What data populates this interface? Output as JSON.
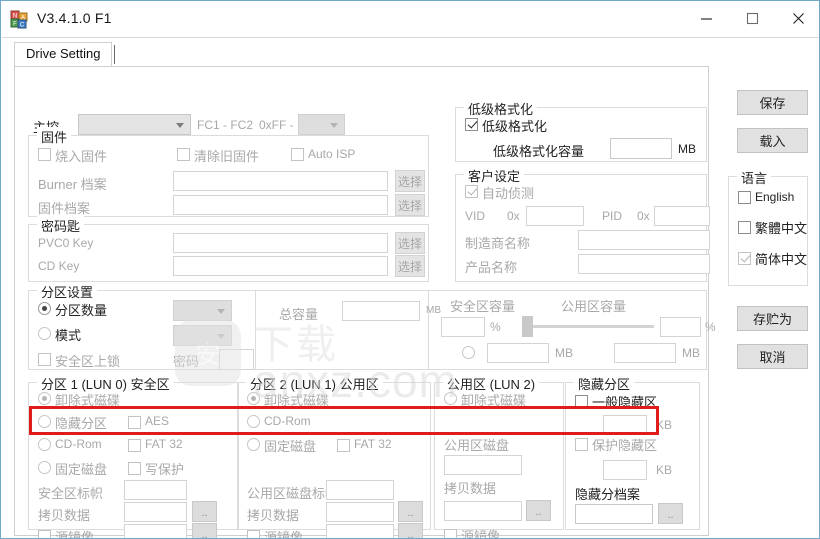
{
  "window": {
    "title": "V3.4.1.0 F1",
    "app_icon": "blocks-icon",
    "minimize": "−",
    "maximize": "□",
    "close": "✕"
  },
  "tabs": [
    {
      "label": "Drive Setting",
      "active": true
    }
  ],
  "controller": {
    "label": "主控",
    "combo_value": "",
    "range_text": "FC1 - FC2",
    "hex_text": "0xFF -",
    "combo2_value": ""
  },
  "firmware": {
    "title": "固件",
    "burn_firmware": "烧入固件",
    "clear_old_firmware": "清除旧固件",
    "auto_isp": "Auto ISP",
    "burner_file_label": "Burner 档案",
    "burner_file_value": "",
    "firmware_file_label": "固件档案",
    "firmware_file_value": "",
    "browse_label": "选择"
  },
  "keys": {
    "title": "密码匙",
    "pvc0_label": "PVC0 Key",
    "pvc0_value": "",
    "cd_label": "CD Key",
    "cd_value": "",
    "browse_label": "选择"
  },
  "partition_settings": {
    "title": "分区设置",
    "count_label": "分区数量",
    "count_value": "",
    "mode_label": "模式",
    "mode_value": "",
    "secure_lock_label": "安全区上锁",
    "password_label": "密码",
    "password_value": ""
  },
  "capacity": {
    "total_label": "总容量",
    "total_value": "",
    "total_unit": "MB",
    "secure_label": "安全区容量",
    "secure_percent": "",
    "secure_percent_unit": "%",
    "secure_mb": "",
    "secure_mb_unit": "MB",
    "public_label": "公用区容量",
    "public_percent": "",
    "public_percent_unit": "%",
    "public_mb": "",
    "public_mb_unit": "MB",
    "slider_position_percent": 4
  },
  "low_level_format": {
    "title": "低级格式化",
    "checkbox_label": "低级格式化",
    "checked": true,
    "capacity_label": "低级格式化容量",
    "capacity_value": "",
    "capacity_unit": "MB"
  },
  "customer_settings": {
    "title": "客户设定",
    "auto_detect": "自动侦测",
    "auto_detect_checked": true,
    "vid_label": "VID",
    "vid_prefix": "0x",
    "vid_value": "",
    "pid_label": "PID",
    "pid_prefix": "0x",
    "pid_value": "",
    "manufacturer_label": "制造商名称",
    "manufacturer_value": "",
    "product_label": "产品名称",
    "product_value": ""
  },
  "partition1": {
    "title": "分区 1 (LUN 0) 安全区",
    "removable": "卸除式磁碟",
    "hidden_partition": "隐藏分区",
    "cdrom": "CD-Rom",
    "fixed_disk": "固定磁盘",
    "aes": "AES",
    "fat32": "FAT 32",
    "write_protect": "写保护",
    "volume_label": "安全区标帜",
    "volume_value": "",
    "copy_data_label": "拷贝数据",
    "copy_data_value": "",
    "source_image_label": "源镜像",
    "source_image_value": "",
    "browse_label": ".."
  },
  "partition2": {
    "title": "分区 2 (LUN 1) 公用区",
    "removable": "卸除式磁碟",
    "cdrom": "CD-Rom",
    "fixed_disk": "固定磁盘",
    "fat32": "FAT 32",
    "volume_label": "公用区磁盘标帜",
    "volume_value": "",
    "copy_data_label": "拷贝数据",
    "copy_data_value": "",
    "source_image_label": "源镜像",
    "source_image_value": "",
    "browse_label": ".."
  },
  "partition3": {
    "title": "公用区 (LUN 2)",
    "removable": "卸除式磁碟",
    "disk_label": "公用区磁盘",
    "disk_value": "",
    "copy_data_label": "拷贝数据",
    "copy_data_value": "",
    "source_image_label": "源镜像",
    "source_image_value": "",
    "browse_label": ".."
  },
  "hidden_partition": {
    "title": "隐藏分区",
    "normal_hidden": "一般隐藏区",
    "normal_value": "",
    "normal_unit": "KB",
    "protected_hidden": "保护隐藏区",
    "protected_value": "",
    "protected_unit": "KB",
    "file_label": "隐藏分档案",
    "file_value": "",
    "browse_label": ".."
  },
  "sidebar": {
    "save": "保存",
    "load": "载入",
    "language_title": "语言",
    "languages": [
      {
        "label": "English",
        "checked": false
      },
      {
        "label": "繁體中文",
        "checked": false
      },
      {
        "label": "简体中文",
        "checked": true
      }
    ],
    "save_as": "存贮为",
    "cancel": "取消"
  },
  "watermark": {
    "badge": "安",
    "cn": "下载",
    "text": "anxz.com"
  },
  "annotation": {
    "highlight_color": "#e01b1b"
  }
}
